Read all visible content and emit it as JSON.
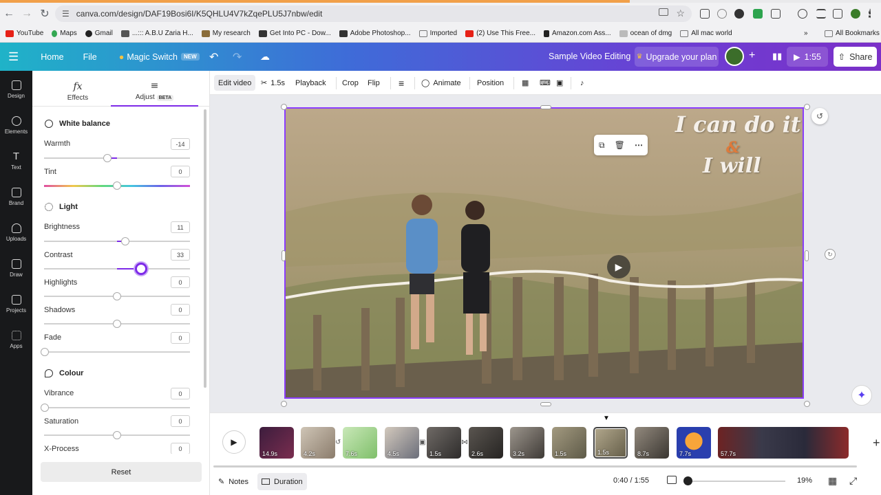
{
  "browser": {
    "url": "canva.com/design/DAF19Bosi6I/K5QHLU4V7kZqePLU5J7nbw/edit",
    "bookmarks": [
      {
        "label": "YouTube",
        "color": "#e62117"
      },
      {
        "label": "Maps",
        "color": "#34a853"
      },
      {
        "label": "Gmail",
        "color": "#333333"
      },
      {
        "label": "...::: A.B.U Zaria H...",
        "color": "#555555"
      },
      {
        "label": "My research",
        "color": "#8a6d3b"
      },
      {
        "label": "Get Into PC - Dow...",
        "color": "#333333"
      },
      {
        "label": "Adobe Photoshop...",
        "color": "#333333"
      },
      {
        "label": "Imported",
        "color": "#777777"
      },
      {
        "label": "(2) Use This Free...",
        "color": "#e62117"
      },
      {
        "label": "Amazon.com Ass...",
        "color": "#222222"
      },
      {
        "label": "ocean of dmg",
        "color": "#999999"
      },
      {
        "label": "All mac world",
        "color": "#777777"
      }
    ],
    "all_bookmarks": "All Bookmarks",
    "more": "»"
  },
  "header": {
    "menu_icon": "☰",
    "home": "Home",
    "file": "File",
    "magic_switch": "Magic Switch",
    "new_badge": "NEW",
    "design_title": "Sample Video Editing",
    "upgrade": "Upgrade your plan",
    "play_time": "1:55",
    "share": "Share"
  },
  "rail": [
    {
      "label": "Design"
    },
    {
      "label": "Elements"
    },
    {
      "label": "Text"
    },
    {
      "label": "Brand"
    },
    {
      "label": "Uploads"
    },
    {
      "label": "Draw"
    },
    {
      "label": "Projects"
    },
    {
      "label": "Apps"
    }
  ],
  "panel": {
    "tab_effects": "Effects",
    "tab_adjust": "Adjust",
    "beta": "BETA",
    "sec_white_balance": "White balance",
    "sec_light": "Light",
    "sec_colour": "Colour",
    "reset": "Reset",
    "sliders": {
      "warmth": {
        "label": "Warmth",
        "value": "-14"
      },
      "tint": {
        "label": "Tint",
        "value": "0"
      },
      "brightness": {
        "label": "Brightness",
        "value": "11"
      },
      "contrast": {
        "label": "Contrast",
        "value": "33"
      },
      "highlights": {
        "label": "Highlights",
        "value": "0"
      },
      "shadows": {
        "label": "Shadows",
        "value": "0"
      },
      "fade": {
        "label": "Fade",
        "value": "0"
      },
      "vibrance": {
        "label": "Vibrance",
        "value": "0"
      },
      "saturation": {
        "label": "Saturation",
        "value": "0"
      },
      "xprocess": {
        "label": "X-Process",
        "value": "0"
      }
    }
  },
  "toolbar": {
    "edit_video": "Edit video",
    "trim": "1.5s",
    "playback": "Playback",
    "crop": "Crop",
    "flip": "Flip",
    "animate": "Animate",
    "position": "Position"
  },
  "canvas": {
    "overlay_line1": "I can do it",
    "overlay_amp": "&",
    "overlay_line2": "I will"
  },
  "timeline": {
    "clips": [
      "14.9s",
      "4.2s",
      "7.6s",
      "4.5s",
      "1.5s",
      "2.6s",
      "3.2s",
      "1.5s",
      "1.5s",
      "8.7s",
      "7.7s",
      "57.7s"
    ]
  },
  "footer": {
    "notes": "Notes",
    "duration": "Duration",
    "time": "0:40 / 1:55",
    "zoom": "19%"
  }
}
